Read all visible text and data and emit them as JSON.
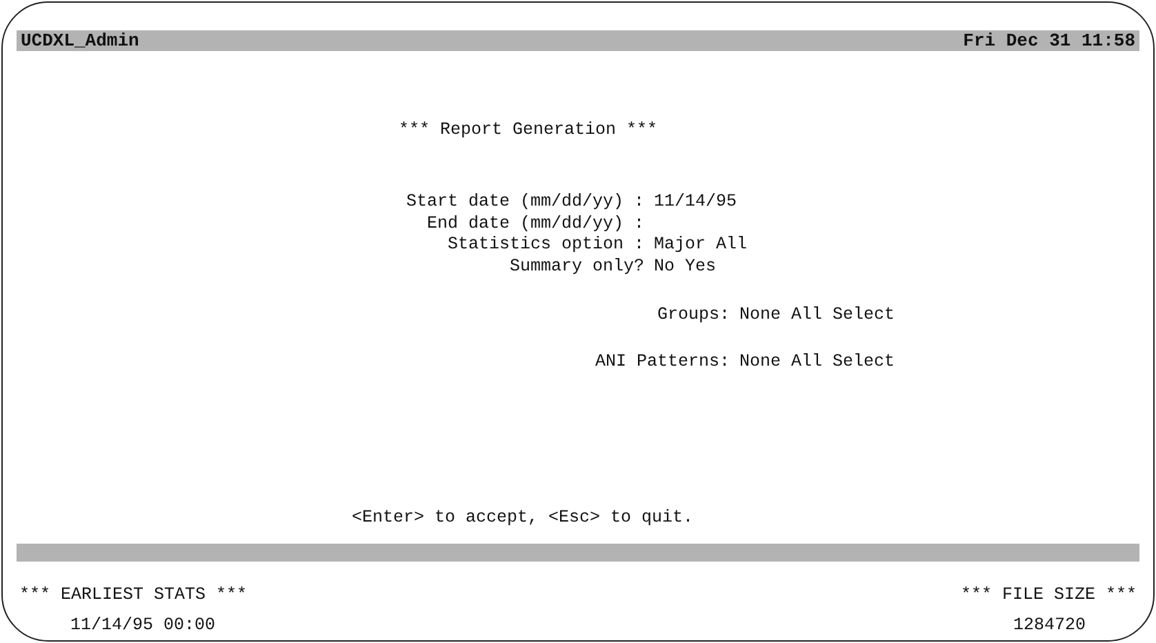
{
  "header": {
    "title": "UCDXL_Admin",
    "clock": "Fri Dec 31 11:58"
  },
  "screen_title": "*** Report Generation ***",
  "fields": [
    {
      "label": "Start date (mm/dd/yy) :",
      "values": [
        "11/14/95"
      ]
    },
    {
      "label": "End date (mm/dd/yy) :"
    },
    {
      "label": "Statistics option :",
      "values": [
        "Major",
        "All"
      ]
    },
    {
      "label": "Summary only?",
      "values": [
        "No",
        "Yes"
      ]
    }
  ],
  "selectors": [
    {
      "label": "Groups:",
      "values": [
        "None",
        "All",
        "Select"
      ]
    },
    {
      "label": "ANI Patterns:",
      "values": [
        "None",
        "All",
        "Select"
      ]
    }
  ],
  "hint": "<Enter> to accept, <Esc> to quit.",
  "footer": {
    "left_heading": "*** EARLIEST STATS ***",
    "left_value": "11/14/95 00:00",
    "right_heading": "*** FILE SIZE ***",
    "right_value": "1284720"
  }
}
